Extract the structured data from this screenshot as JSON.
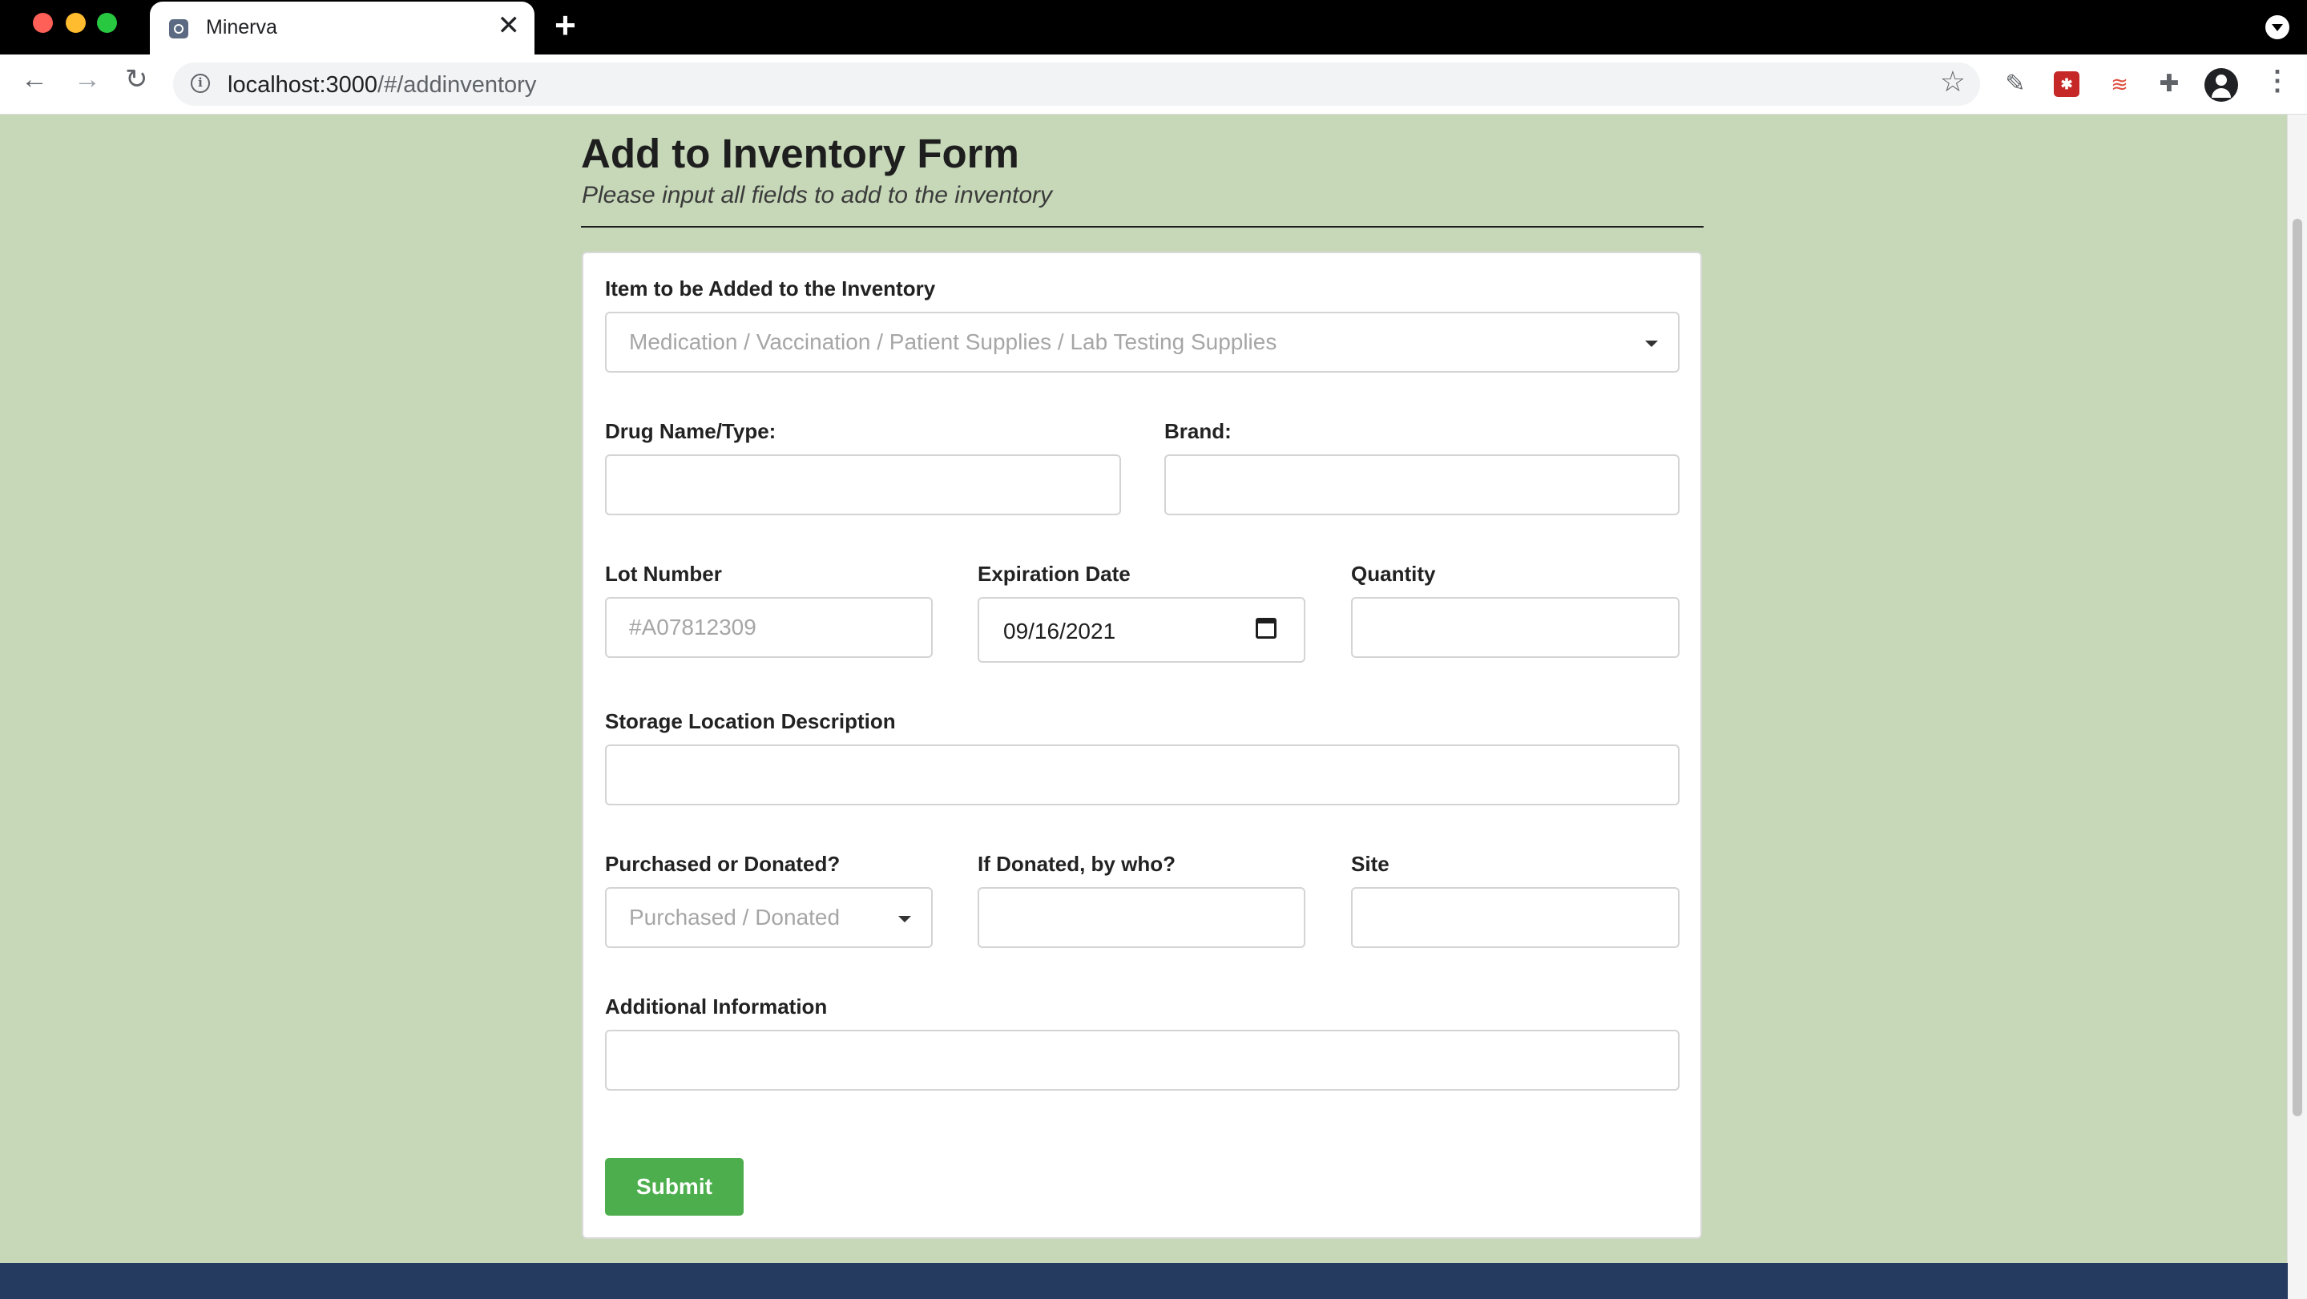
{
  "browser": {
    "tab_title": "Minerva",
    "tab_close": "✕",
    "new_tab": "+",
    "url_host": "localhost:3000",
    "url_path": "/#/addinventory",
    "icons": [
      "minerva-favicon",
      "back-arrow-icon",
      "forward-arrow-icon",
      "reload-icon",
      "info-icon",
      "star-icon",
      "eyedropper-extension-icon",
      "red-extension-icon",
      "lines-extension-icon",
      "puzzle-icon",
      "profile-avatar-icon",
      "more-menu-icon"
    ]
  },
  "form": {
    "title": "Add to Inventory Form",
    "subtitle": "Please input all fields to add to the inventory",
    "item_label": "Item to be Added to the Inventory",
    "item_placeholder": "Medication / Vaccination / Patient Supplies / Lab Testing Supplies",
    "drug_label": "Drug Name/Type:",
    "drug_value": "",
    "brand_label": "Brand:",
    "brand_value": "",
    "lot_label": "Lot Number",
    "lot_placeholder": "#A07812309",
    "expiration_label": "Expiration Date",
    "expiration_value": "09/16/2021",
    "quantity_label": "Quantity",
    "quantity_value": "",
    "storage_label": "Storage Location Description",
    "storage_value": "",
    "purchased_label": "Purchased or Donated?",
    "purchased_placeholder": "Purchased / Donated",
    "donor_label": "If Donated, by who?",
    "donor_value": "",
    "site_label": "Site",
    "site_value": "",
    "additional_label": "Additional Information",
    "additional_value": "",
    "submit_label": "Submit"
  },
  "colors": {
    "page_background": "#c6d8b8",
    "submit_button": "#4cae4c",
    "footer": "#253b60"
  }
}
